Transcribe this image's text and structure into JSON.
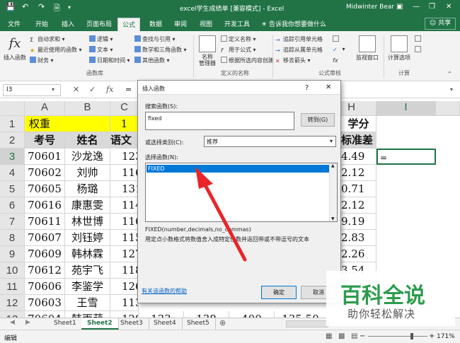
{
  "window": {
    "title": "excel学生成绩单 [兼容模式] - Excel",
    "user": "Midwinter Bear"
  },
  "ribbon_tabs": [
    "文件",
    "开始",
    "插入",
    "页面布局",
    "公式",
    "数据",
    "审阅",
    "视图",
    "开发工具"
  ],
  "active_tab": "公式",
  "tell_me": "告诉我你想要做什么",
  "share": "共享",
  "ribbon": {
    "insert_function": "插入函数",
    "autosum": "自动求和",
    "recent": "最近使用的函数",
    "finance": "财务",
    "logic": "逻辑",
    "text": "文本",
    "datetime": "日期和时间",
    "lookup": "查找与引用",
    "math": "数学和三角函数",
    "other": "其他函数",
    "group_library": "函数库",
    "name_manager": "名称\n管理器",
    "define_name": "定义名称",
    "use_in_formula": "用于公式",
    "create_from_sel": "根据所选内容创建",
    "group_names": "定义的名称",
    "trace_precedents": "追踪引用单元格",
    "trace_dependents": "追踪从属单元格",
    "remove_arrows": "移去箭头",
    "group_audit": "公式审核",
    "watch": "监视窗口",
    "calc_options": "计算选项",
    "group_calc": "计算"
  },
  "name_box": "I3",
  "formula_value": "=",
  "columns": [
    "A",
    "B",
    "C",
    "H",
    "I"
  ],
  "rows": [
    "1",
    "2",
    "3",
    "4",
    "5",
    "6",
    "7",
    "8",
    "9",
    "10",
    "11",
    "12",
    "13"
  ],
  "row1": {
    "a": "权重",
    "c": "1",
    "h": "学分"
  },
  "row2": {
    "a": "考号",
    "b": "姓名",
    "c": "语文",
    "h": "标准差"
  },
  "data_rows": [
    {
      "id": "70601",
      "name": "沙龙逸",
      "c": "123",
      "h": "4.49"
    },
    {
      "id": "70602",
      "name": "刘帅",
      "c": "116",
      "h": "2.12"
    },
    {
      "id": "70605",
      "name": "杨璐",
      "c": "131",
      "h": "0.71"
    },
    {
      "id": "70616",
      "name": "康惠雯",
      "c": "114",
      "h": "2.12"
    },
    {
      "id": "70611",
      "name": "林世博",
      "c": "116",
      "h": "9.19"
    },
    {
      "id": "70607",
      "name": "刘钰婷",
      "c": "115",
      "h": "2.83"
    },
    {
      "id": "70609",
      "name": "韩林霖",
      "c": "127",
      "h": "2.26"
    },
    {
      "id": "70612",
      "name": "苑宇飞",
      "c": "118",
      "h": "3.54"
    },
    {
      "id": "70606",
      "name": "李鉴学",
      "c": "126",
      "h": ""
    },
    {
      "id": "70603",
      "name": "王雪",
      "c": "113",
      "h": ""
    }
  ],
  "row13": {
    "a": "70604",
    "b": "韩雨萌",
    "c": "129",
    "d": "133",
    "e": "138",
    "f": "400",
    "g": "135.50"
  },
  "cell_i3": "=",
  "dialog": {
    "title": "插入函数",
    "help": "?",
    "close": "✕",
    "search_label": "搜索函数(S):",
    "search_value": "fixed",
    "go": "转到(G)",
    "category_label": "或选择类别(C):",
    "category_value": "推荐",
    "select_label": "选择函数(N):",
    "selected_function": "FIXED",
    "signature": "FIXED(number,decimals,no_commas)",
    "description": "用定点小数格式将数值舍入成特定位数并返回带或不带逗号的文本",
    "help_link": "有关该函数的帮助",
    "ok": "确定",
    "cancel": "取消"
  },
  "sheets": [
    "Sheet1",
    "Sheet2",
    "Sheet3",
    "Sheet4",
    "Sheet5"
  ],
  "active_sheet": "Sheet2",
  "status": {
    "mode": "编辑",
    "zoom": "171%"
  },
  "watermark": {
    "title": "百科全说",
    "subtitle": "助你轻松解决"
  },
  "colors": {
    "excel_green": "#217346",
    "highlight_yellow": "#ffff00",
    "arrow_red": "#e8262a"
  }
}
